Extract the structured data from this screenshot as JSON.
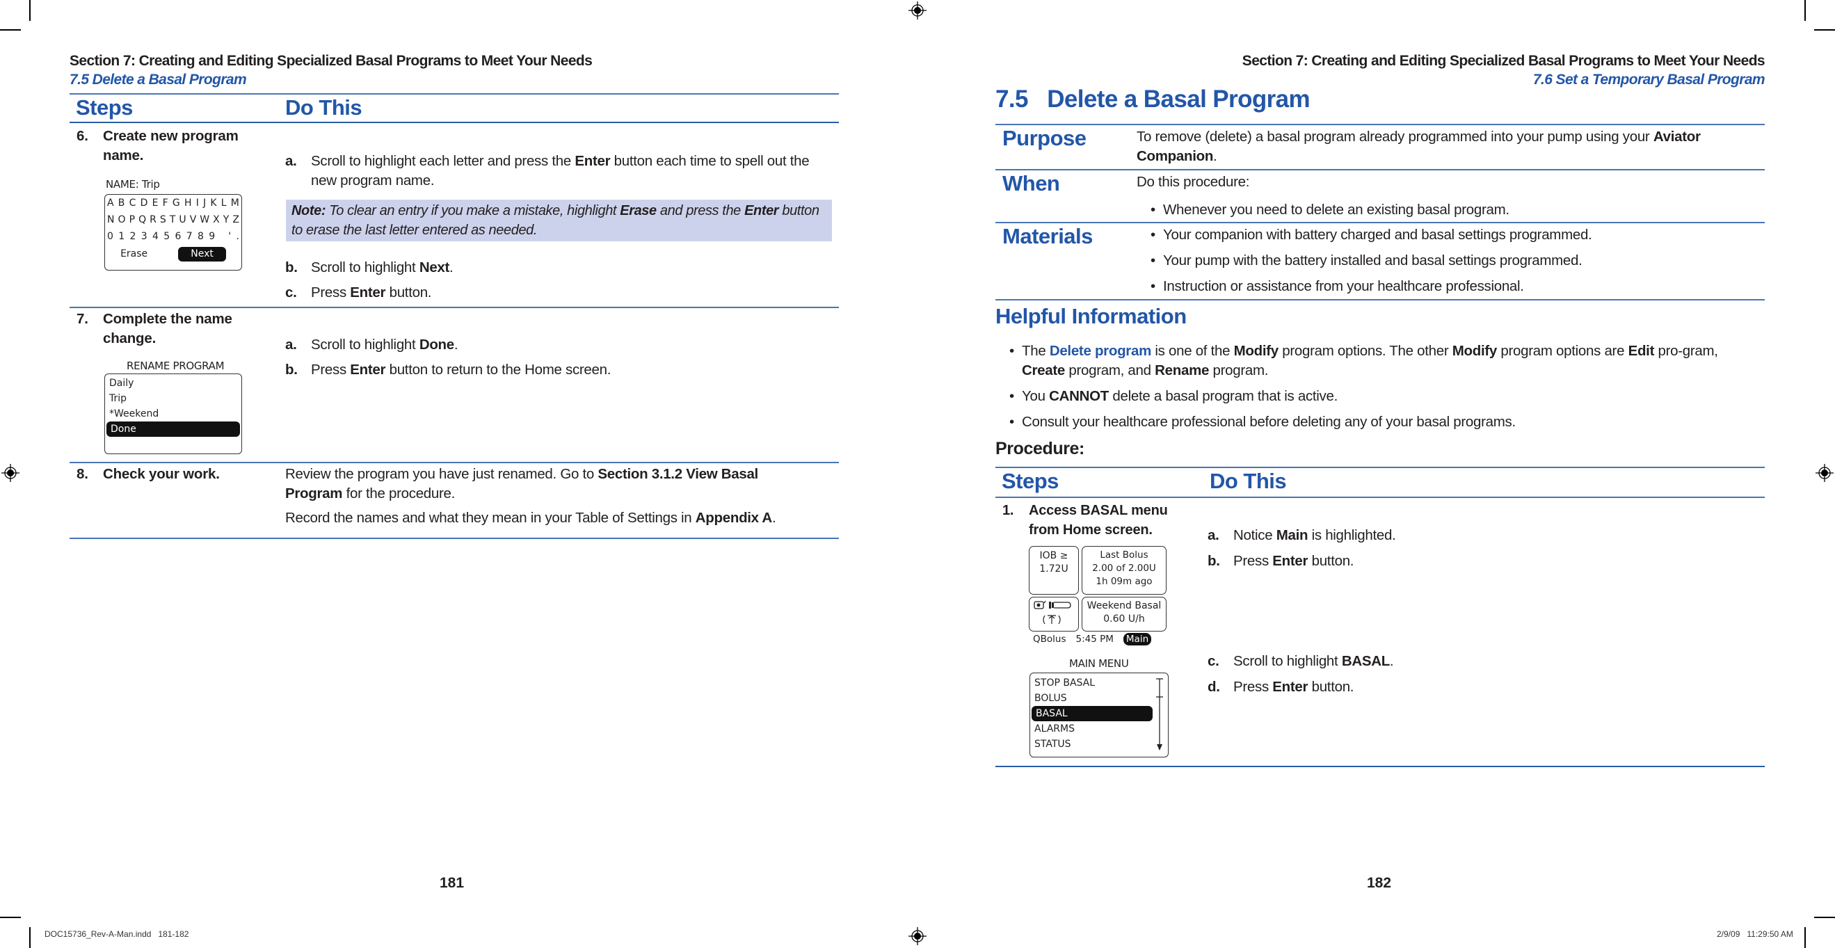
{
  "left_page": {
    "running_header": "Section 7: Creating and Editing Specialized Basal Programs to Meet Your Needs",
    "running_subheader": "7.5 Delete a Basal Program",
    "table_headers": {
      "steps": "Steps",
      "do_this": "Do This"
    },
    "steps": [
      {
        "num": "6.",
        "title_line1": "Create new program",
        "title_line2": "name.",
        "screen": {
          "caption": "NAME: Trip",
          "rows": [
            [
              "A",
              "B",
              "C",
              "D",
              "E",
              "F",
              "G",
              "H",
              "I",
              "J",
              "K",
              "L",
              "M"
            ],
            [
              "N",
              "O",
              "P",
              "Q",
              "R",
              "S",
              "T",
              "U",
              "V",
              "W",
              "X",
              "Y",
              "Z"
            ],
            [
              "0",
              "1",
              "2",
              "3",
              "4",
              "5",
              "6",
              "7",
              "8",
              "9",
              " ",
              "'",
              "."
            ]
          ],
          "erase": "Erase",
          "next": "Next"
        },
        "actions": [
          {
            "label": "a.",
            "pre": "Scroll to highlight each letter and press the ",
            "bold": "Enter",
            "post": " button each time to spell out the new program name."
          },
          {
            "label": "b.",
            "pre": "Scroll to highlight ",
            "bold": "Next",
            "post": "."
          },
          {
            "label": "c.",
            "pre": "Press ",
            "bold": "Enter",
            "post": " button."
          }
        ],
        "note": {
          "label": "Note:",
          "t1": " To clear an entry if you make a mistake, highlight ",
          "b1": "Erase",
          "t2": " and press the ",
          "b2": "Enter",
          "t3": " button to erase the last letter entered as needed."
        }
      },
      {
        "num": "7.",
        "title_line1": "Complete the name",
        "title_line2": "change.",
        "screen": {
          "caption": "RENAME PROGRAM",
          "items": [
            "Daily",
            "Trip",
            "*Weekend",
            "Done"
          ],
          "selected": "Done"
        },
        "actions": [
          {
            "label": "a.",
            "pre": "Scroll to highlight ",
            "bold": "Done",
            "post": "."
          },
          {
            "label": "b.",
            "pre": "Press ",
            "bold": "Enter",
            "post": " button to return to the Home screen."
          }
        ]
      },
      {
        "num": "8.",
        "title_line1": "Check your work.",
        "p1_pre": "Review the program you have just renamed. Go to ",
        "p1_bold": "Section 3.1.2 View Basal Program",
        "p1_post": " for the procedure.",
        "p2_pre": "Record the names and what they mean in your Table of Settings in ",
        "p2_bold": "Appendix A",
        "p2_post": "."
      }
    ],
    "page_number": "181"
  },
  "right_page": {
    "running_header": "Section 7: Creating and Editing Specialized Basal Programs to Meet Your Needs",
    "running_subheader": "7.6 Set a Temporary Basal Program",
    "title": "7.5   Delete a Basal Program",
    "purpose": {
      "label": "Purpose",
      "pre": "To remove (delete) a basal program already programmed into your pump using your ",
      "bold": "Aviator Companion",
      "post": "."
    },
    "when": {
      "label": "When",
      "intro": "Do this procedure:",
      "bullets": [
        "Whenever you need to delete an existing basal program."
      ]
    },
    "materials": {
      "label": "Materials",
      "bullets": [
        "Your companion with battery charged and basal settings programmed.",
        "Your pump with the battery installed and basal settings programmed.",
        "Instruction or assistance from your healthcare professional."
      ]
    },
    "helpful": {
      "heading": "Helpful Information",
      "b1": {
        "t1": "The ",
        "link": "Delete program",
        "t2": " is one of the ",
        "bold1": "Modify",
        "t3": " program options. The other ",
        "bold2": "Modify",
        "t4": " program options are ",
        "bold3": "Edit",
        "t5": " pro-gram, ",
        "bold4": "Create",
        "t6": " program, and ",
        "bold5": "Rename",
        "t7": " program."
      },
      "b2": {
        "t1": "You ",
        "bold": "CANNOT",
        "t2": " delete a basal program that is active."
      },
      "b3": "Consult your healthcare professional before deleting any of your basal programs."
    },
    "procedure_label": "Procedure:",
    "table_headers": {
      "steps": "Steps",
      "do_this": "Do This"
    },
    "step1": {
      "num": "1.",
      "title_line1": "Access BASAL menu",
      "title_line2": "from Home screen.",
      "home_screen": {
        "iob_label": "IOB ≥",
        "iob_value": "1.72U",
        "last_bolus_label": "Last Bolus",
        "last_bolus_value": "2.00 of 2.00U",
        "last_bolus_ago": "1h 09m ago",
        "basal_name": "Weekend Basal",
        "basal_rate": "0.60 U/h",
        "qbolus": "QBolus",
        "time": "5:45 PM",
        "main": "Main"
      },
      "main_menu": {
        "caption": "MAIN MENU",
        "items": [
          "STOP BASAL",
          "BOLUS",
          "BASAL",
          "ALARMS",
          "STATUS"
        ],
        "selected": "BASAL"
      },
      "actions": [
        {
          "label": "a.",
          "pre": "Notice ",
          "bold": "Main",
          "post": " is highlighted."
        },
        {
          "label": "b.",
          "pre": "Press ",
          "bold": "Enter",
          "post": " button."
        },
        {
          "label": "c.",
          "pre": "Scroll to highlight ",
          "bold": "BASAL",
          "post": "."
        },
        {
          "label": "d.",
          "pre": "Press ",
          "bold": "Enter",
          "post": " button."
        }
      ]
    },
    "page_number": "182"
  },
  "slug": {
    "file": "DOC15736_Rev-A-Man.indd   181-182",
    "timestamp": "2/9/09   11:29:50 AM"
  },
  "colors": {
    "accent_blue": "#2256a8",
    "note_bg": "#cdd2ec",
    "rule": "#2a5ba6"
  }
}
